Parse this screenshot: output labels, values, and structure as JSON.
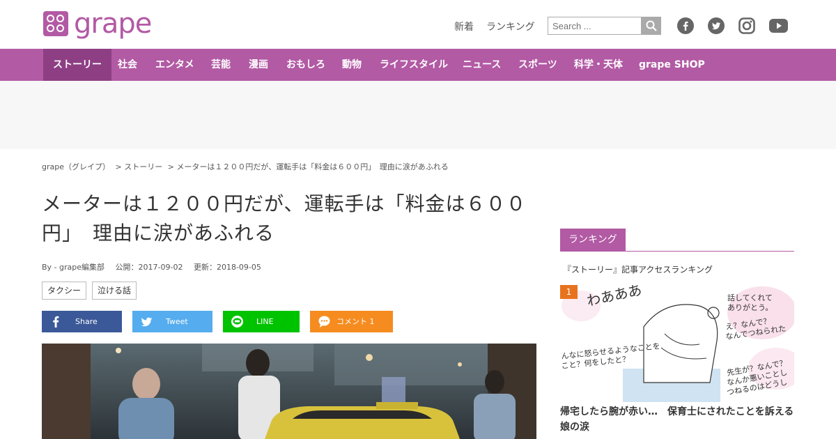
{
  "brand": {
    "name": "grape",
    "accent": "#b25aa4"
  },
  "header": {
    "links": [
      "新着",
      "ランキング"
    ],
    "search_placeholder": "Search ...",
    "social": [
      "facebook-icon",
      "twitter-icon",
      "instagram-icon",
      "youtube-icon"
    ]
  },
  "nav": {
    "items": [
      "ストーリー",
      "社会",
      "エンタメ",
      "芸能",
      "漫画",
      "おもしろ",
      "動物",
      "ライフスタイル",
      "ニュース",
      "スポーツ",
      "科学・天体",
      "grape SHOP"
    ]
  },
  "breadcrumb": [
    "grape（グレイプ）",
    "> ストーリー",
    "> メーターは１２００円だが、運転手は「料金は６００円」　理由に涙があふれる"
  ],
  "article": {
    "title": "メーターは１２００円だが、運転手は「料金は６００円」　理由に涙があふれる",
    "author": "By - grape編集部",
    "published": "公開：2017-09-02",
    "updated": "更新：2018-09-05",
    "tags": [
      "タクシー",
      "泣ける話"
    ],
    "share": {
      "facebook": "Share",
      "twitter": "Tweet",
      "line": "LINE",
      "comment": "コメント 1"
    }
  },
  "sidebar": {
    "tab": "ランキング",
    "subtitle": "『ストーリー』記事アクセスランキング",
    "rank_number": "1",
    "rank_title": "帰宅したら腕が赤い…　保育士にされたことを訴える娘の涙",
    "comic_text": [
      "わあああ",
      "話してくれて",
      "ありがとう。",
      "え？なんで？",
      "なんでつねられた",
      "んなに怒らせるようなことを",
      "こと？何をしたと？",
      "先生が？なんで？",
      "なんか悪いことし",
      "つねるのはどうし"
    ]
  },
  "colors": {
    "facebook": "#3b5998",
    "twitter": "#55acee",
    "line": "#00c300",
    "comment": "#f68c1f",
    "rank_badge": "#e8731f",
    "nav_active": "#8e3f84"
  }
}
